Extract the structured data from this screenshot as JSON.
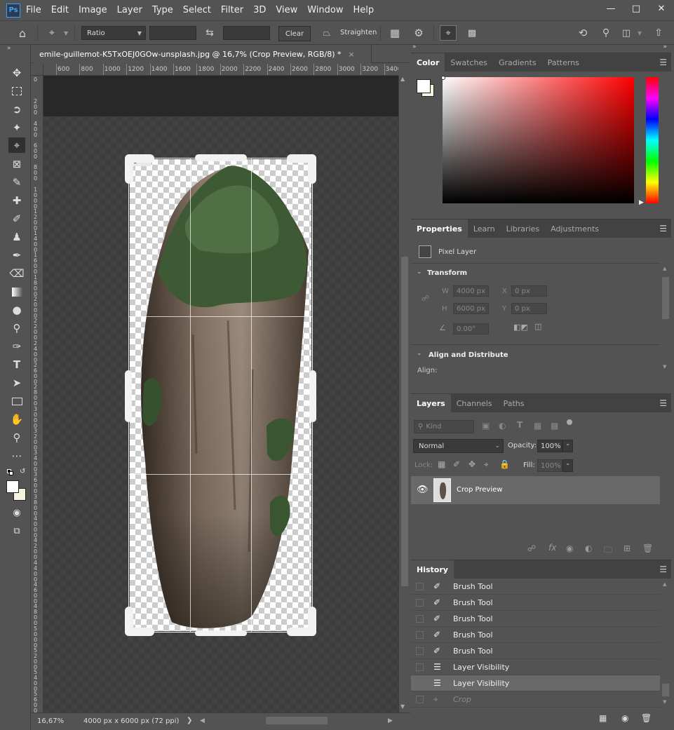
{
  "app": {
    "logo": "Ps",
    "menus": [
      "File",
      "Edit",
      "Image",
      "Layer",
      "Type",
      "Select",
      "Filter",
      "3D",
      "View",
      "Window",
      "Help"
    ],
    "window_controls": [
      "minimize-icon",
      "restore-icon",
      "close-icon"
    ]
  },
  "options": {
    "ratio_label": "Ratio",
    "width_value": "",
    "height_value": "",
    "clear_label": "Clear",
    "straighten_label": "Straighten"
  },
  "document": {
    "tab_title": "emile-guillemot-K5TxOEJ0GOw-unsplash.jpg @ 16,7% (Crop Preview, RGB/8) *",
    "close_glyph": "×",
    "crop_badge": "01",
    "h_ruler": [
      "600",
      "800",
      "1000",
      "1200",
      "1400",
      "1600",
      "1800",
      "2000",
      "2200",
      "2400",
      "2600",
      "2800",
      "3000",
      "3200",
      "3400"
    ],
    "v_ruler": [
      "0",
      "2\n0\n0",
      "4\n0\n0",
      "6\n0\n0",
      "8\n0\n0",
      "1\n0\n0\n0",
      "1\n2\n0\n0",
      "1\n4\n0\n0",
      "1\n6\n0\n0",
      "1\n8\n0\n0",
      "2\n0\n0\n0",
      "2\n2\n0\n0",
      "2\n4\n0\n0",
      "2\n6\n0\n0",
      "2\n8\n0\n0",
      "3\n0\n0\n0",
      "3\n2\n0\n0",
      "3\n4\n0\n0",
      "3\n6\n0\n0",
      "3\n8\n0\n0",
      "4\n0\n0\n0",
      "4\n2\n0\n0",
      "4\n4\n0\n0",
      "4\n6\n0\n0",
      "4\n8\n0\n0",
      "5\n0\n0\n0",
      "5\n2\n0\n0",
      "5\n4\n0\n0",
      "5\n6\n0\n0",
      "5\n8\n0\n0"
    ]
  },
  "status": {
    "zoom": "16,67%",
    "doc_info": "4000 px x 6000 px (72 ppi)",
    "arrow": "❯"
  },
  "color_panel": {
    "tabs": [
      "Color",
      "Swatches",
      "Gradients",
      "Patterns"
    ],
    "hue_color": "#ff0000"
  },
  "properties_panel": {
    "tabs": [
      "Properties",
      "Learn",
      "Libraries",
      "Adjustments"
    ],
    "kind": "Pixel Layer",
    "transform_label": "Transform",
    "w_label": "W",
    "w_value": "4000 px",
    "x_label": "X",
    "x_value": "0 px",
    "h_label": "H",
    "h_value": "6000 px",
    "y_label": "Y",
    "y_value": "0 px",
    "angle_value": "0.00°",
    "align_label": "Align and Distribute",
    "align_sub": "Align:"
  },
  "layers_panel": {
    "tabs": [
      "Layers",
      "Channels",
      "Paths"
    ],
    "kind_placeholder": "Kind",
    "blend_mode": "Normal",
    "opacity_label": "Opacity:",
    "opacity_value": "100%",
    "lock_label": "Lock:",
    "fill_label": "Fill:",
    "fill_value": "100%",
    "layer_name": "Crop Preview"
  },
  "history_panel": {
    "tab": "History",
    "items": [
      {
        "label": "Brush Tool",
        "icon": "brush-icon",
        "state": "normal"
      },
      {
        "label": "Brush Tool",
        "icon": "brush-icon",
        "state": "normal"
      },
      {
        "label": "Brush Tool",
        "icon": "brush-icon",
        "state": "normal"
      },
      {
        "label": "Brush Tool",
        "icon": "brush-icon",
        "state": "normal"
      },
      {
        "label": "Brush Tool",
        "icon": "brush-icon",
        "state": "normal"
      },
      {
        "label": "Layer Visibility",
        "icon": "document-icon",
        "state": "normal"
      },
      {
        "label": "Layer Visibility",
        "icon": "document-icon",
        "state": "selected"
      },
      {
        "label": "Crop",
        "icon": "crop-icon",
        "state": "pending"
      }
    ]
  },
  "colors": {
    "panel_bg": "#535353",
    "dark_bg": "#424242",
    "selected_row": "#696969",
    "accent_blue": "#31a8ff"
  }
}
